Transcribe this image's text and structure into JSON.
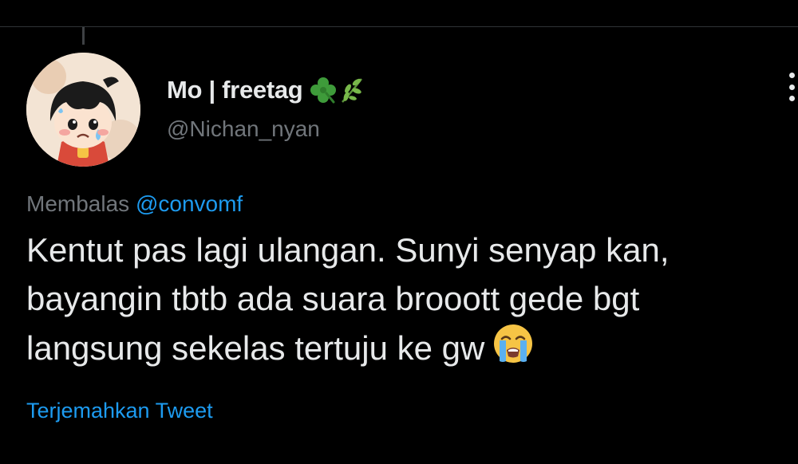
{
  "author": {
    "display_name": "Mo | freetag",
    "name_emoji": [
      "clover-icon",
      "herb-icon"
    ],
    "handle": "@Nichan_nyan"
  },
  "tweet": {
    "reply_prefix": "Membalas",
    "reply_to": "@convomf",
    "lines": [
      "Kentut pas lagi ulangan. Sunyi senyap kan,",
      "bayangin tbtb ada suara brooott gede bgt",
      "langsung sekelas tertuju ke gw"
    ],
    "trailing_emoji": "loudly-crying-face-icon",
    "translate_label": "Terjemahkan Tweet"
  },
  "colors": {
    "background": "#000000",
    "text_primary": "#e7e9ea",
    "text_secondary": "#71767b",
    "link": "#1d9bf0",
    "divider": "#2f3336"
  }
}
